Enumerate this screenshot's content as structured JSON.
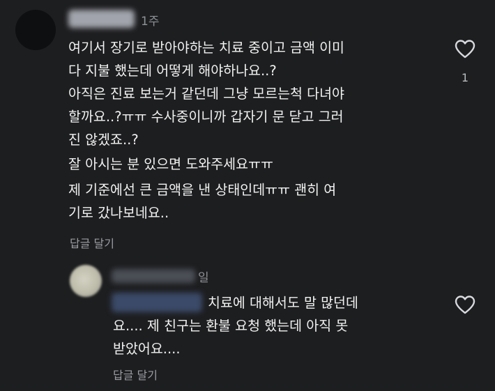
{
  "comment": {
    "time": "1주",
    "paragraphs": [
      "여기서 장기로 받아야하는 치료 중이고 금액 이미\n다 지불 했는데 어떻게 해야하나요..?",
      "아직은 진료 보는거 같던데 그냥 모르는척 다녀야\n할까요..?ㅠㅠ 수사중이니까 갑자기 문 닫고 그러\n진 않겠죠..?",
      "잘 아시는 분 있으면 도와주세요ㅠㅠ",
      "제 기준에선 큰 금액을 낸 상태인데ㅠㅠ 괜히 여\n기로 갔나보네요.."
    ],
    "reply_label": "답글 달기",
    "like_count": "1"
  },
  "reply": {
    "time": "일",
    "text": "치료에 대해서도 말 많던데\n요.... 제 친구는 환불 요청 했는데 아직 못\n받았어요....",
    "reply_label": "답글 달기"
  },
  "icons": {
    "like": "heart-outline-icon"
  },
  "colors": {
    "background": "#1d1e20",
    "text": "#f1f1f1",
    "muted": "#9a9da2"
  }
}
